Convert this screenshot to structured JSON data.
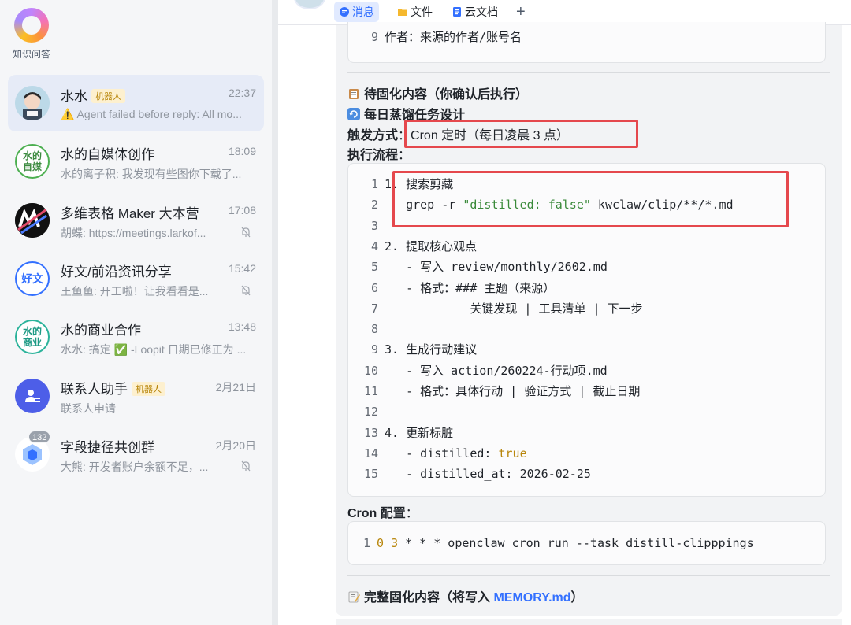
{
  "brand": {
    "label": "知识问答"
  },
  "chats": [
    {
      "name": "水水",
      "tag": "机器人",
      "time": "22:37",
      "preview": "⚠️ Agent failed before reply: All mo...",
      "muted": false,
      "active": true
    },
    {
      "name": "水的自媒体创作",
      "tag": "",
      "time": "18:09",
      "preview": "水的离子积: 我发现有些图你下载了...",
      "muted": false,
      "avatar_text": "水的\n自媒"
    },
    {
      "name": "多维表格 Maker 大本营",
      "tag": "",
      "time": "17:08",
      "preview": "胡蝶: https://meetings.larkof...",
      "muted": true
    },
    {
      "name": "好文/前沿资讯分享",
      "tag": "",
      "time": "15:42",
      "preview": "王鱼鱼: 开工啦！让我看看是...",
      "muted": true,
      "avatar_text": "好文"
    },
    {
      "name": "水的商业合作",
      "tag": "",
      "time": "13:48",
      "preview": "水水: 搞定 ✅ -Loopit 日期已修正为 ...",
      "muted": false,
      "avatar_text": "水的\n商业"
    },
    {
      "name": "联系人助手",
      "tag": "机器人",
      "time": "2月21日",
      "preview": "联系人申请",
      "muted": false
    },
    {
      "name": "字段捷径共创群",
      "tag": "",
      "time": "2月20日",
      "preview": "大熊: 开发者账户余额不足，...",
      "muted": true,
      "badge": "132"
    }
  ],
  "tabs": [
    {
      "label": "消息",
      "icon": "chat-bubble-icon",
      "active": true
    },
    {
      "label": "文件",
      "icon": "folder-icon",
      "active": false
    },
    {
      "label": "云文档",
      "icon": "doc-icon",
      "active": false
    }
  ],
  "tab_add": "+",
  "message": {
    "top_code_line": {
      "num": "9",
      "text": "作者：来源的作者/账号名"
    },
    "pending_title": "待固化内容（你确认后执行）",
    "task_title": "每日蒸馏任务设计",
    "trigger_label": "触发方式",
    "trigger_value": "Cron 定时（每日凌晨 3 点）",
    "flow_label": "执行流程",
    "flow_lines": [
      {
        "num": "1",
        "text": "1. 搜索剪藏"
      },
      {
        "num": "2",
        "pre": "   grep -r ",
        "str": "\"distilled: false\"",
        "post": " kwclaw/clip/**/*.md"
      },
      {
        "num": "3",
        "text": ""
      },
      {
        "num": "4",
        "text": "2. 提取核心观点"
      },
      {
        "num": "5",
        "text": "   - 写入 review/monthly/2602.md"
      },
      {
        "num": "6",
        "text": "   - 格式：### 主题（来源）"
      },
      {
        "num": "7",
        "text": "            关键发现 | 工具清单 | 下一步"
      },
      {
        "num": "8",
        "text": ""
      },
      {
        "num": "9",
        "text": "3. 生成行动建议"
      },
      {
        "num": "10",
        "text": "   - 写入 action/260224-行动项.md"
      },
      {
        "num": "11",
        "text": "   - 格式：具体行动 | 验证方式 | 截止日期"
      },
      {
        "num": "12",
        "text": ""
      },
      {
        "num": "13",
        "text": "4. 更新标脏"
      },
      {
        "num": "14",
        "pre": "   - distilled: ",
        "kw": "true"
      },
      {
        "num": "15",
        "text": "   - distilled_at: 2026-02-25"
      }
    ],
    "cron_label": "Cron 配置",
    "cron_line": {
      "num": "1",
      "k1": "0",
      "k2": "3",
      "rest": " * * * openclaw cron run --task distill-clipppings"
    },
    "full_title_pre": "完整固化内容（将写入 ",
    "full_title_link": "MEMORY.md",
    "full_title_post": "）"
  },
  "colors": {
    "accent": "#3370ff",
    "highlight_box": "#e5484d",
    "sidebar_bg": "#f5f6f8",
    "active_chat_bg": "#e6ebf7",
    "string": "#3a8a3a",
    "keyword": "#b8860b"
  }
}
